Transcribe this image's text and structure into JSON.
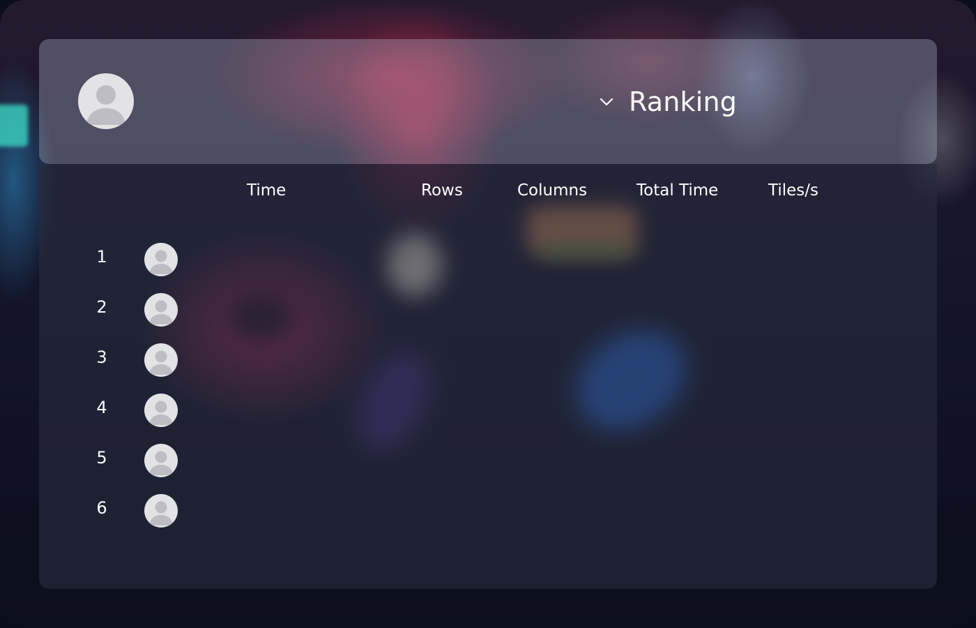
{
  "header": {
    "title": "Ranking",
    "chevron_icon": "chevron-down-icon",
    "user_avatar_icon": "default-avatar-icon"
  },
  "table": {
    "columns": [
      "Time",
      "Rows",
      "Columns",
      "Total Time",
      "Tiles/s"
    ],
    "rows": [
      {
        "rank": "1",
        "avatar_icon": "default-avatar-icon"
      },
      {
        "rank": "2",
        "avatar_icon": "default-avatar-icon"
      },
      {
        "rank": "3",
        "avatar_icon": "default-avatar-icon"
      },
      {
        "rank": "4",
        "avatar_icon": "default-avatar-icon"
      },
      {
        "rank": "5",
        "avatar_icon": "default-avatar-icon"
      },
      {
        "rank": "6",
        "avatar_icon": "default-avatar-icon"
      }
    ]
  },
  "colors": {
    "avatar_bg": "#e3e3e6",
    "avatar_fg": "#bdbdc3",
    "text": "#ffffff"
  }
}
